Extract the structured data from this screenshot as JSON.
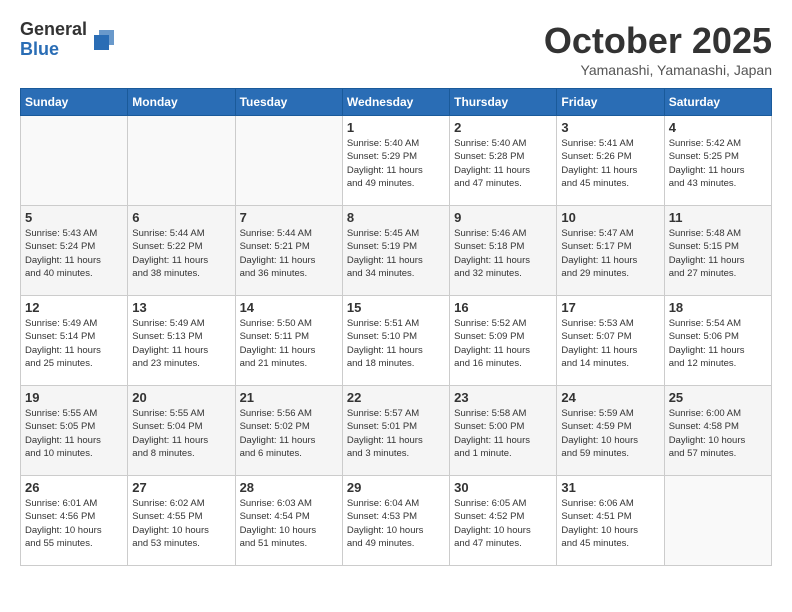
{
  "header": {
    "logo_general": "General",
    "logo_blue": "Blue",
    "title": "October 2025",
    "location": "Yamanashi, Yamanashi, Japan"
  },
  "weekdays": [
    "Sunday",
    "Monday",
    "Tuesday",
    "Wednesday",
    "Thursday",
    "Friday",
    "Saturday"
  ],
  "weeks": [
    [
      {
        "day": "",
        "info": ""
      },
      {
        "day": "",
        "info": ""
      },
      {
        "day": "",
        "info": ""
      },
      {
        "day": "1",
        "info": "Sunrise: 5:40 AM\nSunset: 5:29 PM\nDaylight: 11 hours\nand 49 minutes."
      },
      {
        "day": "2",
        "info": "Sunrise: 5:40 AM\nSunset: 5:28 PM\nDaylight: 11 hours\nand 47 minutes."
      },
      {
        "day": "3",
        "info": "Sunrise: 5:41 AM\nSunset: 5:26 PM\nDaylight: 11 hours\nand 45 minutes."
      },
      {
        "day": "4",
        "info": "Sunrise: 5:42 AM\nSunset: 5:25 PM\nDaylight: 11 hours\nand 43 minutes."
      }
    ],
    [
      {
        "day": "5",
        "info": "Sunrise: 5:43 AM\nSunset: 5:24 PM\nDaylight: 11 hours\nand 40 minutes."
      },
      {
        "day": "6",
        "info": "Sunrise: 5:44 AM\nSunset: 5:22 PM\nDaylight: 11 hours\nand 38 minutes."
      },
      {
        "day": "7",
        "info": "Sunrise: 5:44 AM\nSunset: 5:21 PM\nDaylight: 11 hours\nand 36 minutes."
      },
      {
        "day": "8",
        "info": "Sunrise: 5:45 AM\nSunset: 5:19 PM\nDaylight: 11 hours\nand 34 minutes."
      },
      {
        "day": "9",
        "info": "Sunrise: 5:46 AM\nSunset: 5:18 PM\nDaylight: 11 hours\nand 32 minutes."
      },
      {
        "day": "10",
        "info": "Sunrise: 5:47 AM\nSunset: 5:17 PM\nDaylight: 11 hours\nand 29 minutes."
      },
      {
        "day": "11",
        "info": "Sunrise: 5:48 AM\nSunset: 5:15 PM\nDaylight: 11 hours\nand 27 minutes."
      }
    ],
    [
      {
        "day": "12",
        "info": "Sunrise: 5:49 AM\nSunset: 5:14 PM\nDaylight: 11 hours\nand 25 minutes."
      },
      {
        "day": "13",
        "info": "Sunrise: 5:49 AM\nSunset: 5:13 PM\nDaylight: 11 hours\nand 23 minutes."
      },
      {
        "day": "14",
        "info": "Sunrise: 5:50 AM\nSunset: 5:11 PM\nDaylight: 11 hours\nand 21 minutes."
      },
      {
        "day": "15",
        "info": "Sunrise: 5:51 AM\nSunset: 5:10 PM\nDaylight: 11 hours\nand 18 minutes."
      },
      {
        "day": "16",
        "info": "Sunrise: 5:52 AM\nSunset: 5:09 PM\nDaylight: 11 hours\nand 16 minutes."
      },
      {
        "day": "17",
        "info": "Sunrise: 5:53 AM\nSunset: 5:07 PM\nDaylight: 11 hours\nand 14 minutes."
      },
      {
        "day": "18",
        "info": "Sunrise: 5:54 AM\nSunset: 5:06 PM\nDaylight: 11 hours\nand 12 minutes."
      }
    ],
    [
      {
        "day": "19",
        "info": "Sunrise: 5:55 AM\nSunset: 5:05 PM\nDaylight: 11 hours\nand 10 minutes."
      },
      {
        "day": "20",
        "info": "Sunrise: 5:55 AM\nSunset: 5:04 PM\nDaylight: 11 hours\nand 8 minutes."
      },
      {
        "day": "21",
        "info": "Sunrise: 5:56 AM\nSunset: 5:02 PM\nDaylight: 11 hours\nand 6 minutes."
      },
      {
        "day": "22",
        "info": "Sunrise: 5:57 AM\nSunset: 5:01 PM\nDaylight: 11 hours\nand 3 minutes."
      },
      {
        "day": "23",
        "info": "Sunrise: 5:58 AM\nSunset: 5:00 PM\nDaylight: 11 hours\nand 1 minute."
      },
      {
        "day": "24",
        "info": "Sunrise: 5:59 AM\nSunset: 4:59 PM\nDaylight: 10 hours\nand 59 minutes."
      },
      {
        "day": "25",
        "info": "Sunrise: 6:00 AM\nSunset: 4:58 PM\nDaylight: 10 hours\nand 57 minutes."
      }
    ],
    [
      {
        "day": "26",
        "info": "Sunrise: 6:01 AM\nSunset: 4:56 PM\nDaylight: 10 hours\nand 55 minutes."
      },
      {
        "day": "27",
        "info": "Sunrise: 6:02 AM\nSunset: 4:55 PM\nDaylight: 10 hours\nand 53 minutes."
      },
      {
        "day": "28",
        "info": "Sunrise: 6:03 AM\nSunset: 4:54 PM\nDaylight: 10 hours\nand 51 minutes."
      },
      {
        "day": "29",
        "info": "Sunrise: 6:04 AM\nSunset: 4:53 PM\nDaylight: 10 hours\nand 49 minutes."
      },
      {
        "day": "30",
        "info": "Sunrise: 6:05 AM\nSunset: 4:52 PM\nDaylight: 10 hours\nand 47 minutes."
      },
      {
        "day": "31",
        "info": "Sunrise: 6:06 AM\nSunset: 4:51 PM\nDaylight: 10 hours\nand 45 minutes."
      },
      {
        "day": "",
        "info": ""
      }
    ]
  ]
}
